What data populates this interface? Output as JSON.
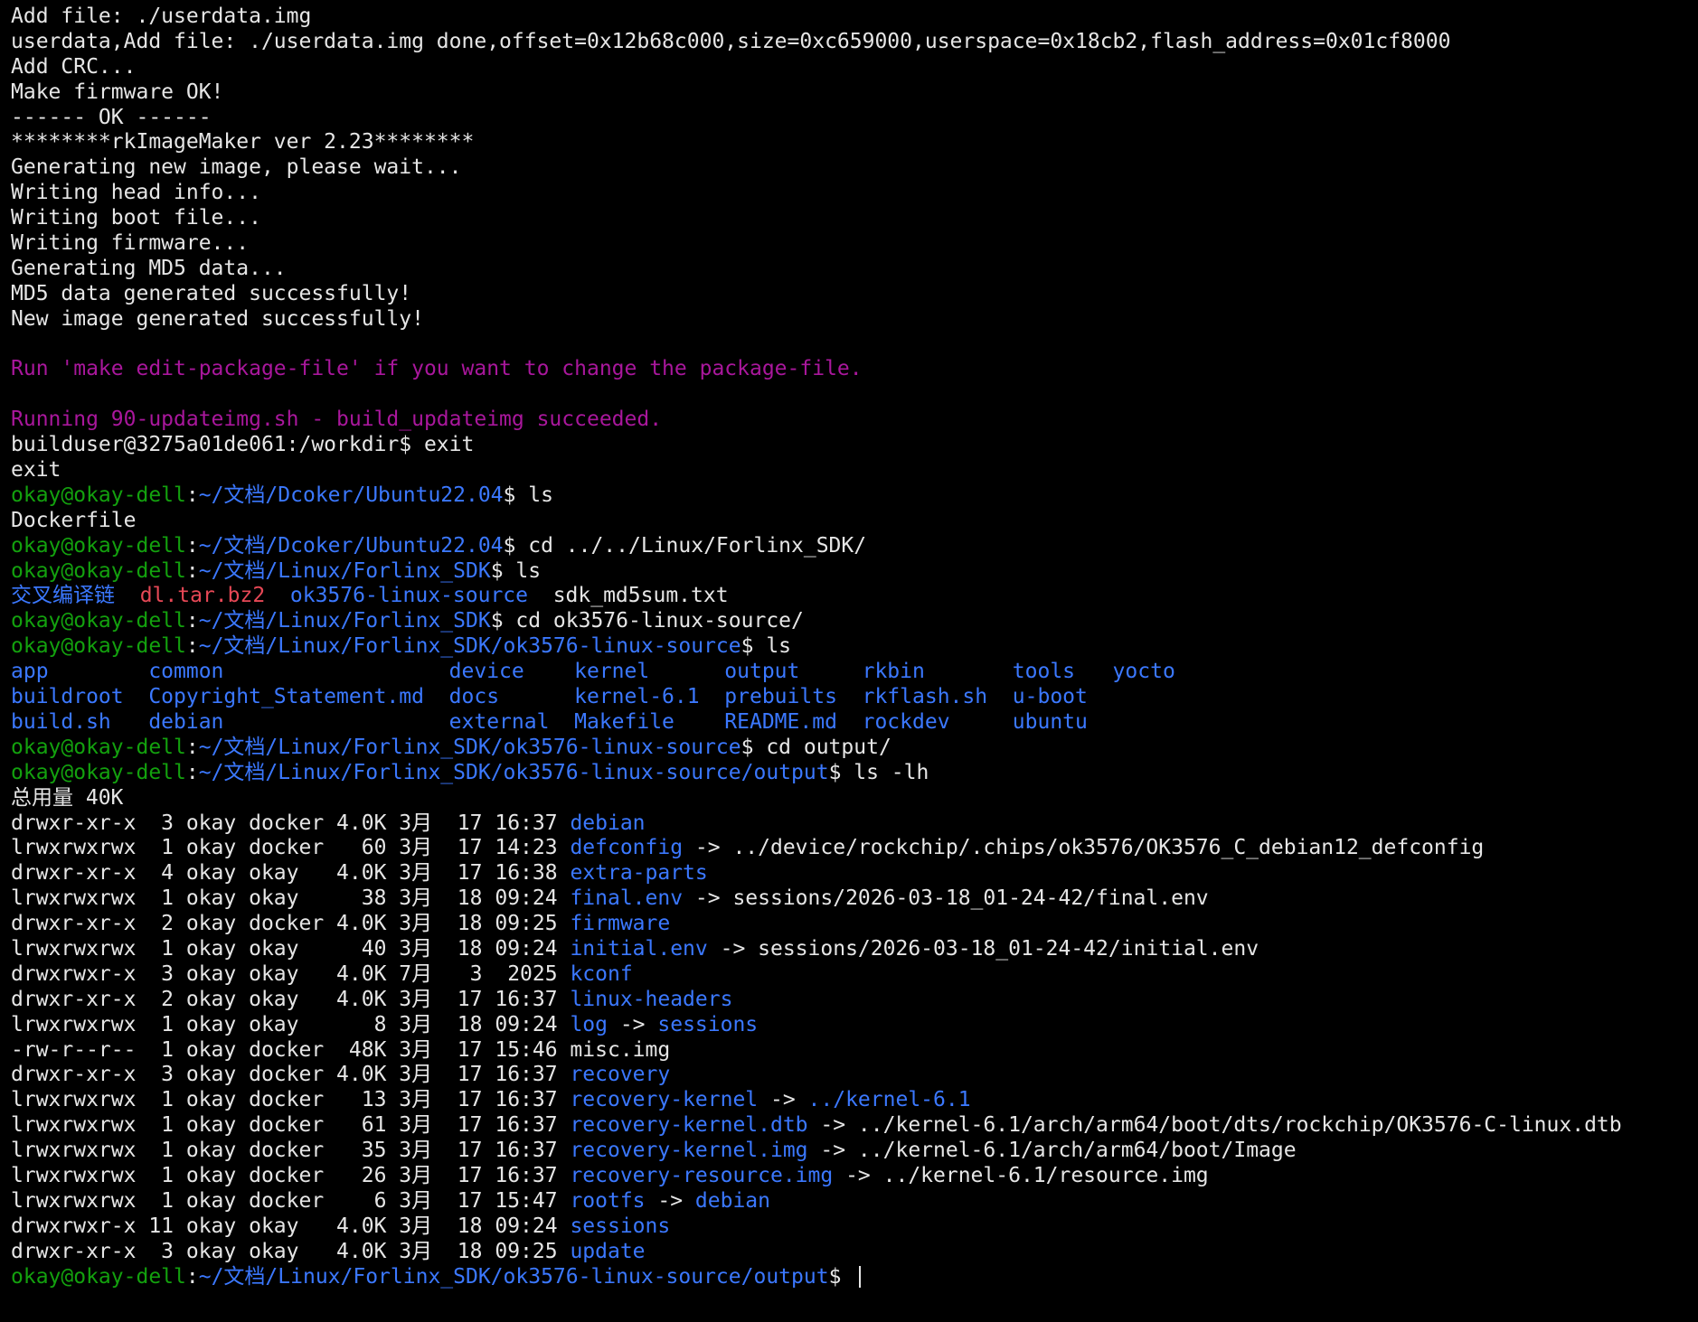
{
  "colors": {
    "background": "#000000",
    "text": "#e6e6e6",
    "prompt_user": "#13a10e",
    "prompt_path": "#3b78ff",
    "directory": "#3b78ff",
    "info": "#a9179c",
    "archive": "#e74856"
  },
  "terminal": {
    "lines": [
      [
        {
          "t": "Add file: ./userdata.img",
          "c": "text"
        }
      ],
      [
        {
          "t": "userdata,Add file: ./userdata.img done,offset=0x12b68c000,size=0xc659000,userspace=0x18cb2,flash_address=0x01cf8000",
          "c": "text"
        }
      ],
      [
        {
          "t": "Add CRC...",
          "c": "text"
        }
      ],
      [
        {
          "t": "Make firmware OK!",
          "c": "text"
        }
      ],
      [
        {
          "t": "------ OK ------",
          "c": "text"
        }
      ],
      [
        {
          "t": "********rkImageMaker ver 2.23********",
          "c": "text"
        }
      ],
      [
        {
          "t": "Generating new image, please wait...",
          "c": "text"
        }
      ],
      [
        {
          "t": "Writing head info...",
          "c": "text"
        }
      ],
      [
        {
          "t": "Writing boot file...",
          "c": "text"
        }
      ],
      [
        {
          "t": "Writing firmware...",
          "c": "text"
        }
      ],
      [
        {
          "t": "Generating MD5 data...",
          "c": "text"
        }
      ],
      [
        {
          "t": "MD5 data generated successfully!",
          "c": "text"
        }
      ],
      [
        {
          "t": "New image generated successfully!",
          "c": "text"
        }
      ],
      [],
      [
        {
          "t": "Run 'make edit-package-file' if you want to change the package-file.",
          "c": "purple"
        }
      ],
      [],
      [
        {
          "t": "Running 90-updateimg.sh - build_updateimg succeeded.",
          "c": "purple"
        }
      ],
      [
        {
          "t": "builduser@3275a01de061:/workdir$ exit",
          "c": "text"
        }
      ],
      [
        {
          "t": "exit",
          "c": "text"
        }
      ],
      [
        {
          "t": "okay@okay-dell",
          "c": "green"
        },
        {
          "t": ":",
          "c": "text"
        },
        {
          "t": "~/文档/Dcoker/Ubuntu22.04",
          "c": "blue"
        },
        {
          "t": "$ ls",
          "c": "text"
        }
      ],
      [
        {
          "t": "Dockerfile",
          "c": "text"
        }
      ],
      [
        {
          "t": "okay@okay-dell",
          "c": "green"
        },
        {
          "t": ":",
          "c": "text"
        },
        {
          "t": "~/文档/Dcoker/Ubuntu22.04",
          "c": "blue"
        },
        {
          "t": "$ cd ../../Linux/Forlinx_SDK/",
          "c": "text"
        }
      ],
      [
        {
          "t": "okay@okay-dell",
          "c": "green"
        },
        {
          "t": ":",
          "c": "text"
        },
        {
          "t": "~/文档/Linux/Forlinx_SDK",
          "c": "blue"
        },
        {
          "t": "$ ls",
          "c": "text"
        }
      ],
      [
        {
          "t": "交叉编译链",
          "c": "blue"
        },
        {
          "t": "  ",
          "c": "text"
        },
        {
          "t": "dl.tar.bz2",
          "c": "red"
        },
        {
          "t": "  ",
          "c": "text"
        },
        {
          "t": "ok3576-linux-source",
          "c": "blue"
        },
        {
          "t": "  sdk_md5sum.txt",
          "c": "text"
        }
      ],
      [
        {
          "t": "okay@okay-dell",
          "c": "green"
        },
        {
          "t": ":",
          "c": "text"
        },
        {
          "t": "~/文档/Linux/Forlinx_SDK",
          "c": "blue"
        },
        {
          "t": "$ cd ok3576-linux-source/",
          "c": "text"
        }
      ],
      [
        {
          "t": "okay@okay-dell",
          "c": "green"
        },
        {
          "t": ":",
          "c": "text"
        },
        {
          "t": "~/文档/Linux/Forlinx_SDK/ok3576-linux-source",
          "c": "blue"
        },
        {
          "t": "$ ls",
          "c": "text"
        }
      ],
      [
        {
          "t": "app        common                  device    kernel      output     rkbin       tools   yocto",
          "c": "blue"
        }
      ],
      [
        {
          "t": "buildroot  Copyright_Statement.md  docs      kernel-6.1  prebuilts  rkflash.sh  u-boot",
          "c": "blue"
        }
      ],
      [
        {
          "t": "build.sh   debian                  external  Makefile    README.md  rockdev     ubuntu",
          "c": "blue"
        }
      ],
      [
        {
          "t": "okay@okay-dell",
          "c": "green"
        },
        {
          "t": ":",
          "c": "text"
        },
        {
          "t": "~/文档/Linux/Forlinx_SDK/ok3576-linux-source",
          "c": "blue"
        },
        {
          "t": "$ cd output/",
          "c": "text"
        }
      ],
      [
        {
          "t": "okay@okay-dell",
          "c": "green"
        },
        {
          "t": ":",
          "c": "text"
        },
        {
          "t": "~/文档/Linux/Forlinx_SDK/ok3576-linux-source/output",
          "c": "blue"
        },
        {
          "t": "$ ls -lh",
          "c": "text"
        }
      ],
      [
        {
          "t": "总用量 40K",
          "c": "text"
        }
      ],
      [
        {
          "t": "drwxr-xr-x  3 okay docker 4.0K 3月  17 16:37 ",
          "c": "text"
        },
        {
          "t": "debian",
          "c": "blue"
        }
      ],
      [
        {
          "t": "lrwxrwxrwx  1 okay docker   60 3月  17 14:23 ",
          "c": "text"
        },
        {
          "t": "defconfig",
          "c": "blue"
        },
        {
          "t": " -> ../device/rockchip/.chips/ok3576/OK3576_C_debian12_defconfig",
          "c": "text"
        }
      ],
      [
        {
          "t": "drwxr-xr-x  4 okay okay   4.0K 3月  17 16:38 ",
          "c": "text"
        },
        {
          "t": "extra-parts",
          "c": "blue"
        }
      ],
      [
        {
          "t": "lrwxrwxrwx  1 okay okay     38 3月  18 09:24 ",
          "c": "text"
        },
        {
          "t": "final.env",
          "c": "blue"
        },
        {
          "t": " -> sessions/2026-03-18_01-24-42/final.env",
          "c": "text"
        }
      ],
      [
        {
          "t": "drwxr-xr-x  2 okay docker 4.0K 3月  18 09:25 ",
          "c": "text"
        },
        {
          "t": "firmware",
          "c": "blue"
        }
      ],
      [
        {
          "t": "lrwxrwxrwx  1 okay okay     40 3月  18 09:24 ",
          "c": "text"
        },
        {
          "t": "initial.env",
          "c": "blue"
        },
        {
          "t": " -> sessions/2026-03-18_01-24-42/initial.env",
          "c": "text"
        }
      ],
      [
        {
          "t": "drwxrwxr-x  3 okay okay   4.0K 7月   3  2025 ",
          "c": "text"
        },
        {
          "t": "kconf",
          "c": "blue"
        }
      ],
      [
        {
          "t": "drwxr-xr-x  2 okay okay   4.0K 3月  17 16:37 ",
          "c": "text"
        },
        {
          "t": "linux-headers",
          "c": "blue"
        }
      ],
      [
        {
          "t": "lrwxrwxrwx  1 okay okay      8 3月  18 09:24 ",
          "c": "text"
        },
        {
          "t": "log",
          "c": "blue"
        },
        {
          "t": " -> ",
          "c": "text"
        },
        {
          "t": "sessions",
          "c": "blue"
        }
      ],
      [
        {
          "t": "-rw-r--r--  1 okay docker  48K 3月  17 15:46 misc.img",
          "c": "text"
        }
      ],
      [
        {
          "t": "drwxr-xr-x  3 okay docker 4.0K 3月  17 16:37 ",
          "c": "text"
        },
        {
          "t": "recovery",
          "c": "blue"
        }
      ],
      [
        {
          "t": "lrwxrwxrwx  1 okay docker   13 3月  17 16:37 ",
          "c": "text"
        },
        {
          "t": "recovery-kernel",
          "c": "blue"
        },
        {
          "t": " -> ",
          "c": "text"
        },
        {
          "t": "../kernel-6.1",
          "c": "blue"
        }
      ],
      [
        {
          "t": "lrwxrwxrwx  1 okay docker   61 3月  17 16:37 ",
          "c": "text"
        },
        {
          "t": "recovery-kernel.dtb",
          "c": "blue"
        },
        {
          "t": " -> ../kernel-6.1/arch/arm64/boot/dts/rockchip/OK3576-C-linux.dtb",
          "c": "text"
        }
      ],
      [
        {
          "t": "lrwxrwxrwx  1 okay docker   35 3月  17 16:37 ",
          "c": "text"
        },
        {
          "t": "recovery-kernel.img",
          "c": "blue"
        },
        {
          "t": " -> ../kernel-6.1/arch/arm64/boot/Image",
          "c": "text"
        }
      ],
      [
        {
          "t": "lrwxrwxrwx  1 okay docker   26 3月  17 16:37 ",
          "c": "text"
        },
        {
          "t": "recovery-resource.img",
          "c": "blue"
        },
        {
          "t": " -> ../kernel-6.1/resource.img",
          "c": "text"
        }
      ],
      [
        {
          "t": "lrwxrwxrwx  1 okay docker    6 3月  17 15:47 ",
          "c": "text"
        },
        {
          "t": "rootfs",
          "c": "blue"
        },
        {
          "t": " -> ",
          "c": "text"
        },
        {
          "t": "debian",
          "c": "blue"
        }
      ],
      [
        {
          "t": "drwxrwxr-x 11 okay okay   4.0K 3月  18 09:24 ",
          "c": "text"
        },
        {
          "t": "sessions",
          "c": "blue"
        }
      ],
      [
        {
          "t": "drwxr-xr-x  3 okay okay   4.0K 3月  18 09:25 ",
          "c": "text"
        },
        {
          "t": "update",
          "c": "blue"
        }
      ],
      [
        {
          "t": "okay@okay-dell",
          "c": "green"
        },
        {
          "t": ":",
          "c": "text"
        },
        {
          "t": "~/文档/Linux/Forlinx_SDK/ok3576-linux-source/output",
          "c": "blue"
        },
        {
          "t": "$ ",
          "c": "text"
        }
      ]
    ]
  }
}
